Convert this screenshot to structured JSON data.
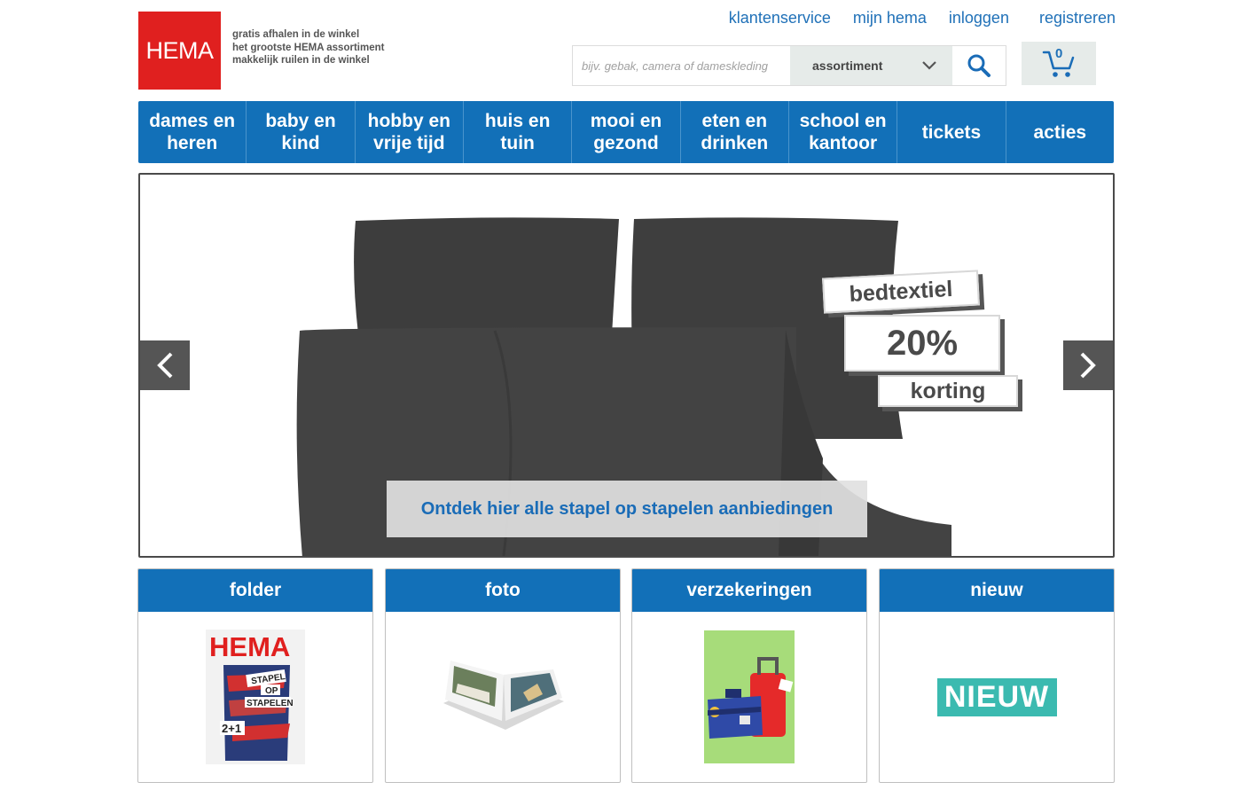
{
  "brand": {
    "logo_text": "HEMA",
    "color": "#e0201f",
    "taglines": [
      "gratis afhalen in de winkel",
      "het grootste HEMA assortiment",
      "makkelijk ruilen in de winkel"
    ]
  },
  "header": {
    "links": [
      "klantenservice",
      "mijn hema",
      "inloggen",
      "registreren"
    ],
    "search": {
      "placeholder": "bijv. gebak, camera of dameskleding",
      "select_value": "assortiment"
    },
    "cart": {
      "count": "0"
    }
  },
  "nav": {
    "items": [
      "dames en heren",
      "baby en kind",
      "hobby en vrije tijd",
      "huis en tuin",
      "mooi en gezond",
      "eten en drinken",
      "school en kantoor",
      "tickets",
      "acties"
    ]
  },
  "banner": {
    "tag_line1": "bedtextiel",
    "tag_line2": "20%",
    "tag_line3": "korting",
    "cta": "Ontdek hier alle stapel op stapelen aanbiedingen"
  },
  "cards": [
    {
      "title": "folder",
      "cover_brand": "HEMA",
      "cover_lines": [
        "STAPEL",
        "OP",
        "STAPELEN"
      ],
      "cover_promo": "2+1"
    },
    {
      "title": "foto"
    },
    {
      "title": "verzekeringen"
    },
    {
      "title": "nieuw",
      "badge": "NIEUW"
    }
  ],
  "colors": {
    "primary_blue": "#1270b8",
    "link_blue": "#2071b8",
    "nieuw_teal": "#3bbab0"
  }
}
